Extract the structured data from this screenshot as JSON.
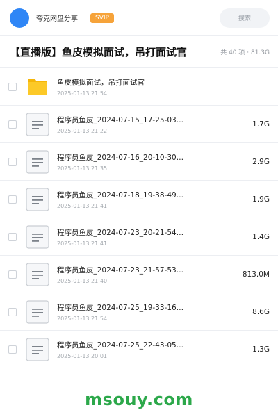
{
  "topbar": {
    "app_name": "夸克网盘分享",
    "svip_badge": "SVIP",
    "search_label": "搜索",
    "avatar_color": "#2f86f6"
  },
  "header": {
    "title": "【直播版】鱼皮模拟面试，吊打面试官",
    "summary": "共 40 项 · 81.3G"
  },
  "files": [
    {
      "type": "folder",
      "icon": "folder-icon",
      "name": "鱼皮模拟面试，吊打面试官",
      "date": "2025-01-13 21:54",
      "size": ""
    },
    {
      "type": "file",
      "icon": "document-icon",
      "name": "程序员鱼皮_2024-07-15_17-25-03…",
      "date": "2025-01-13 21:22",
      "size": "1.7G"
    },
    {
      "type": "file",
      "icon": "document-icon",
      "name": "程序员鱼皮_2024-07-16_20-10-30…",
      "date": "2025-01-13 21:35",
      "size": "2.9G"
    },
    {
      "type": "file",
      "icon": "document-icon",
      "name": "程序员鱼皮_2024-07-18_19-38-49…",
      "date": "2025-01-13 21:41",
      "size": "1.9G"
    },
    {
      "type": "file",
      "icon": "document-icon",
      "name": "程序员鱼皮_2024-07-23_20-21-54…",
      "date": "2025-01-13 21:41",
      "size": "1.4G"
    },
    {
      "type": "file",
      "icon": "document-icon",
      "name": "程序员鱼皮_2024-07-23_21-57-53…",
      "date": "2025-01-13 21:40",
      "size": "813.0M"
    },
    {
      "type": "file",
      "icon": "document-icon",
      "name": "程序员鱼皮_2024-07-25_19-33-16…",
      "date": "2025-01-13 21:54",
      "size": "8.6G"
    },
    {
      "type": "file",
      "icon": "document-icon",
      "name": "程序员鱼皮_2024-07-25_22-43-05…",
      "date": "2025-01-13 20:01",
      "size": "1.3G"
    }
  ],
  "footer": {
    "watermark": "msouy.com",
    "watermark_color": "#2ca84a"
  }
}
